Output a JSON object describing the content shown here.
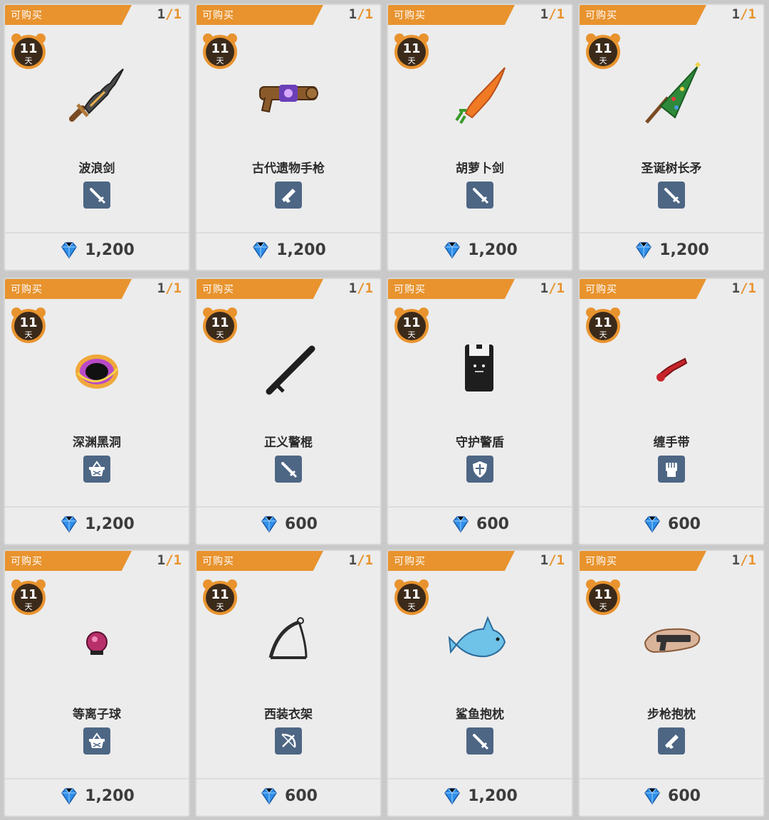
{
  "cards": [
    {
      "status": "可购买",
      "qty_current": "1",
      "qty_sep": "/",
      "qty_max": "1",
      "timer_num": "11",
      "timer_unit": "天",
      "name": "波浪剑",
      "type": "sword-icon",
      "price": "1,200",
      "art": "wave-sword"
    },
    {
      "status": "可购买",
      "qty_current": "1",
      "qty_sep": "/",
      "qty_max": "1",
      "timer_num": "11",
      "timer_unit": "天",
      "name": "古代遗物手枪",
      "type": "gun-icon",
      "price": "1,200",
      "art": "relic-pistol"
    },
    {
      "status": "可购买",
      "qty_current": "1",
      "qty_sep": "/",
      "qty_max": "1",
      "timer_num": "11",
      "timer_unit": "天",
      "name": "胡萝卜剑",
      "type": "sword-icon",
      "price": "1,200",
      "art": "carrot-sword"
    },
    {
      "status": "可购买",
      "qty_current": "1",
      "qty_sep": "/",
      "qty_max": "1",
      "timer_num": "11",
      "timer_unit": "天",
      "name": "圣诞树长矛",
      "type": "sword-icon",
      "price": "1,200",
      "art": "xmas-spear"
    },
    {
      "status": "可购买",
      "qty_current": "1",
      "qty_sep": "/",
      "qty_max": "1",
      "timer_num": "11",
      "timer_unit": "天",
      "name": "深渊黑洞",
      "type": "basket-icon",
      "price": "1,200",
      "art": "black-hole"
    },
    {
      "status": "可购买",
      "qty_current": "1",
      "qty_sep": "/",
      "qty_max": "1",
      "timer_num": "11",
      "timer_unit": "天",
      "name": "正义警棍",
      "type": "sword-icon",
      "price": "600",
      "art": "baton"
    },
    {
      "status": "可购买",
      "qty_current": "1",
      "qty_sep": "/",
      "qty_max": "1",
      "timer_num": "11",
      "timer_unit": "天",
      "name": "守护警盾",
      "type": "shield-icon",
      "price": "600",
      "art": "riot-shield"
    },
    {
      "status": "可购买",
      "qty_current": "1",
      "qty_sep": "/",
      "qty_max": "1",
      "timer_num": "11",
      "timer_unit": "天",
      "name": "缠手带",
      "type": "fist-icon",
      "price": "600",
      "art": "hand-wrap"
    },
    {
      "status": "可购买",
      "qty_current": "1",
      "qty_sep": "/",
      "qty_max": "1",
      "timer_num": "11",
      "timer_unit": "天",
      "name": "等离子球",
      "type": "basket-icon",
      "price": "1,200",
      "art": "plasma-ball"
    },
    {
      "status": "可购买",
      "qty_current": "1",
      "qty_sep": "/",
      "qty_max": "1",
      "timer_num": "11",
      "timer_unit": "天",
      "name": "西装衣架",
      "type": "bow-icon",
      "price": "600",
      "art": "hanger"
    },
    {
      "status": "可购买",
      "qty_current": "1",
      "qty_sep": "/",
      "qty_max": "1",
      "timer_num": "11",
      "timer_unit": "天",
      "name": "鲨鱼抱枕",
      "type": "sword-icon",
      "price": "1,200",
      "art": "shark-pillow"
    },
    {
      "status": "可购买",
      "qty_current": "1",
      "qty_sep": "/",
      "qty_max": "1",
      "timer_num": "11",
      "timer_unit": "天",
      "name": "步枪抱枕",
      "type": "gun-icon",
      "price": "600",
      "art": "rifle-pillow"
    }
  ],
  "colors": {
    "banner": "#e8932e",
    "type_icon_bg": "#4d6684",
    "gem": "#2f8fe8",
    "timer_bg": "#3b2a1a",
    "timer_ring": "#e8932e"
  }
}
